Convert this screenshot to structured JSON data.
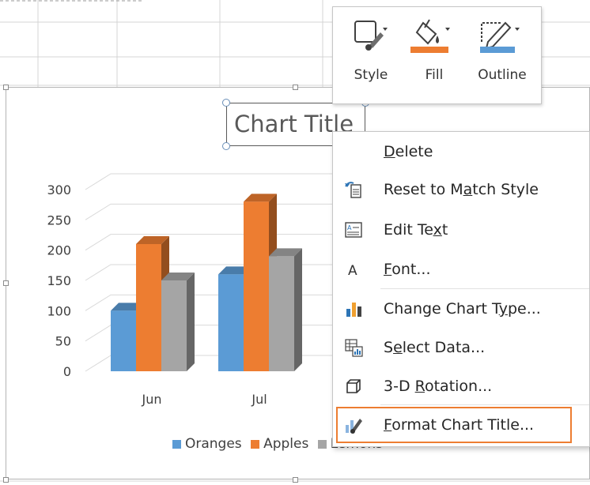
{
  "chart_data": {
    "type": "bar",
    "title": "Chart Title",
    "categories": [
      "Jun",
      "Jul"
    ],
    "series": [
      {
        "name": "Oranges",
        "color": "#5b9bd5",
        "values": [
          100,
          160
        ]
      },
      {
        "name": "Apples",
        "color": "#ed7d31",
        "values": [
          210,
          280
        ]
      },
      {
        "name": "Lemons",
        "color": "#a5a5a5",
        "values": [
          150,
          190
        ]
      }
    ],
    "y_ticks": [
      "300",
      "250",
      "200",
      "150",
      "100",
      "50",
      "0"
    ],
    "ylim": [
      0,
      300
    ],
    "grid": true,
    "legend": "bottom",
    "style": "3d-clustered-column"
  },
  "toolbar": {
    "style_label": "Style",
    "fill_label": "Fill",
    "outline_label": "Outline",
    "fill_color": "#ed7d31",
    "outline_color": "#5b9bd5"
  },
  "menu": {
    "delete": {
      "pre": "",
      "key": "D",
      "post": "elete",
      "icon": "none"
    },
    "reset": {
      "pre": "Reset to M",
      "key": "a",
      "post": "tch Style",
      "icon": "reset-style-icon"
    },
    "edit_text": {
      "pre": "Edit Te",
      "key": "x",
      "post": "t",
      "icon": "edit-text-icon"
    },
    "font": {
      "pre": "",
      "key": "F",
      "post": "ont...",
      "icon": "font-icon"
    },
    "change_type": {
      "pre": "Change Chart T",
      "key": "y",
      "post": "pe...",
      "icon": "bar-chart-icon"
    },
    "select_data": {
      "pre": "S",
      "key": "e",
      "post": "lect Data...",
      "icon": "select-data-icon"
    },
    "rotation": {
      "pre": "3-D ",
      "key": "R",
      "post": "otation...",
      "icon": "cube-icon"
    },
    "format_title": {
      "pre": "",
      "key": "F",
      "post": "ormat Chart Title...",
      "icon": "format-shape-icon"
    }
  },
  "legend_partial": "Lemons"
}
